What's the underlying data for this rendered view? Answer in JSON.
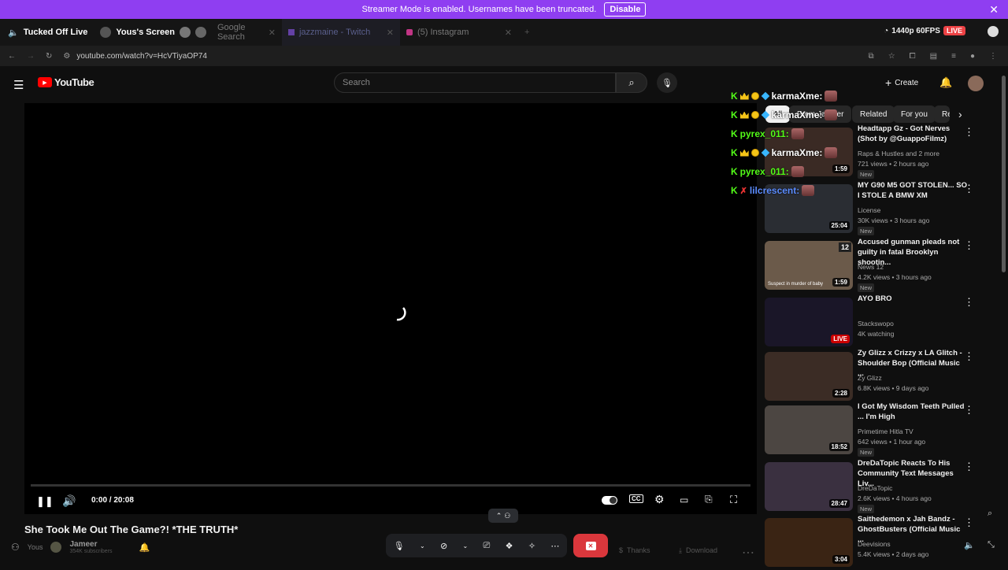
{
  "banner": {
    "text": "Streamer Mode is enabled. Usernames have been truncated.",
    "button": "Disable"
  },
  "stream": {
    "channel": "Tucked Off Live",
    "screen_label": "Yous's Screen",
    "quality": "1440p 60FPS",
    "live": "LIVE"
  },
  "tabs": [
    {
      "label": "Google Search"
    },
    {
      "label": "jazzmaine - Twitch"
    },
    {
      "label": "(5) Instagram"
    }
  ],
  "url": "youtube.com/watch?v=HcVTiyaOP74",
  "youtube": {
    "logo": "YouTube",
    "search_placeholder": "Search",
    "create": "Create"
  },
  "player": {
    "time": "0:00 / 20:08",
    "progress": 0
  },
  "chips": [
    "All",
    "From Jameer",
    "Related",
    "For you",
    "Re"
  ],
  "chat": [
    {
      "user": "karmaXme:"
    },
    {
      "user": "karmaXme:"
    },
    {
      "user": "pyrex_011:"
    },
    {
      "user": "karmaXme:"
    },
    {
      "user": "pyrex_011:"
    },
    {
      "user": "lilcrescent:"
    }
  ],
  "videos": [
    {
      "title": "Headtapp Gz - Got Nerves (Shot by @GuappoFilmz)",
      "channel": "Raps & Hustles and 2 more",
      "meta": "721 views • 2 hours ago",
      "badge": "New",
      "duration": "1:59",
      "thumb_color": "#3a2a24"
    },
    {
      "title": "MY G90 M5 GOT STOLEN... SO I STOLE A BMW XM",
      "channel": "License",
      "meta": "30K views • 3 hours ago",
      "badge": "New",
      "duration": "25:04",
      "thumb_color": "#2a2d33"
    },
    {
      "title": "Accused gunman pleads not guilty in fatal Brooklyn shootin...",
      "channel": "News 12",
      "meta": "4.2K views • 3 hours ago",
      "badge": "New",
      "duration": "1:59",
      "thumb_color": "#6b5a4a",
      "overlay": "Suspect in murder of baby",
      "logo": "12"
    },
    {
      "title": "AYO BRO",
      "channel": "Stackswopo",
      "meta": "4K watching",
      "badge": "",
      "duration": "LIVE",
      "thumb_color": "#1a1628"
    },
    {
      "title": "Zy Glizz x Crizzy x LA Glitch - Shoulder Bop (Official Music ...",
      "channel": "Zy Glizz",
      "meta": "6.8K views • 9 days ago",
      "badge": "",
      "duration": "2:28",
      "thumb_color": "#3b2c25"
    },
    {
      "title": "I Got My Wisdom Teeth Pulled ... I'm High",
      "channel": "Primetime Hitla TV",
      "meta": "642 views • 1 hour ago",
      "badge": "New",
      "duration": "18:52",
      "thumb_color": "#4c4642"
    },
    {
      "title": "DreDaTopic Reacts To His Community Text Messages Liv...",
      "channel": "DreDaTopic",
      "meta": "2.6K views • 4 hours ago",
      "badge": "New",
      "duration": "28:47",
      "thumb_color": "#3a3040"
    },
    {
      "title": "Saithedemon x Jah Bandz - GhostBusters (Official Music ...",
      "channel": "Deevisions",
      "meta": "5.4K views • 2 days ago",
      "badge": "",
      "duration": "3:04",
      "thumb_color": "#3a2414"
    }
  ],
  "below": {
    "video_title": "She Took Me Out The Game?! *THE TRUTH*",
    "channel_name": "Jameer",
    "subs": "354K subscribers",
    "thanks": "Thanks",
    "download": "Download",
    "yous": "Yous"
  }
}
